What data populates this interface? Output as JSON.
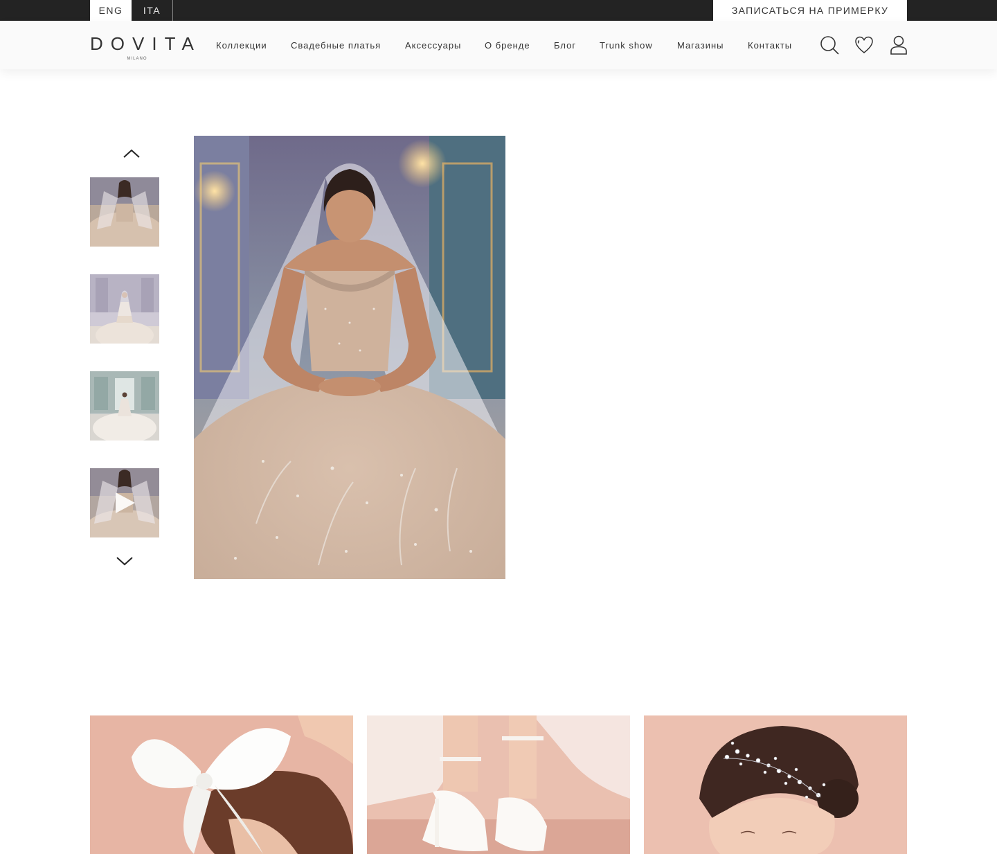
{
  "topbar": {
    "languages": [
      {
        "label": "ENG",
        "active": true
      },
      {
        "label": "ITA",
        "active": false
      }
    ],
    "fitting_button": "ЗАПИСАТЬСЯ НА ПРИМЕРКУ"
  },
  "header": {
    "logo": "DOVITA",
    "logo_sub": "MILANO",
    "nav": [
      "Коллекции",
      "Свадебные платья",
      "Аксессуары",
      "О бренде",
      "Блог",
      "Trunk show",
      "Магазины",
      "Контакты"
    ],
    "icons": [
      "search-icon",
      "heart-icon",
      "user-icon"
    ]
  },
  "gallery": {
    "thumbnails": [
      {
        "icon": "dress-closeup-photo"
      },
      {
        "icon": "dress-full-length-photo"
      },
      {
        "icon": "dress-train-photo"
      },
      {
        "icon": "video-thumbnail",
        "overlay_icon": "play-icon"
      }
    ],
    "nav_icons": [
      "chevron-up-icon",
      "chevron-down-icon"
    ],
    "main_photo": "bridal-gown-photo"
  },
  "accessories": [
    {
      "icon": "bow-hair-accessory-photo"
    },
    {
      "icon": "bridal-shoes-photo"
    },
    {
      "icon": "hair-vine-photo"
    }
  ],
  "colors": {
    "topbar_bg": "#232323",
    "header_bg": "#fafafa",
    "text": "#333333",
    "accent_pink": "#e9b8a8"
  }
}
